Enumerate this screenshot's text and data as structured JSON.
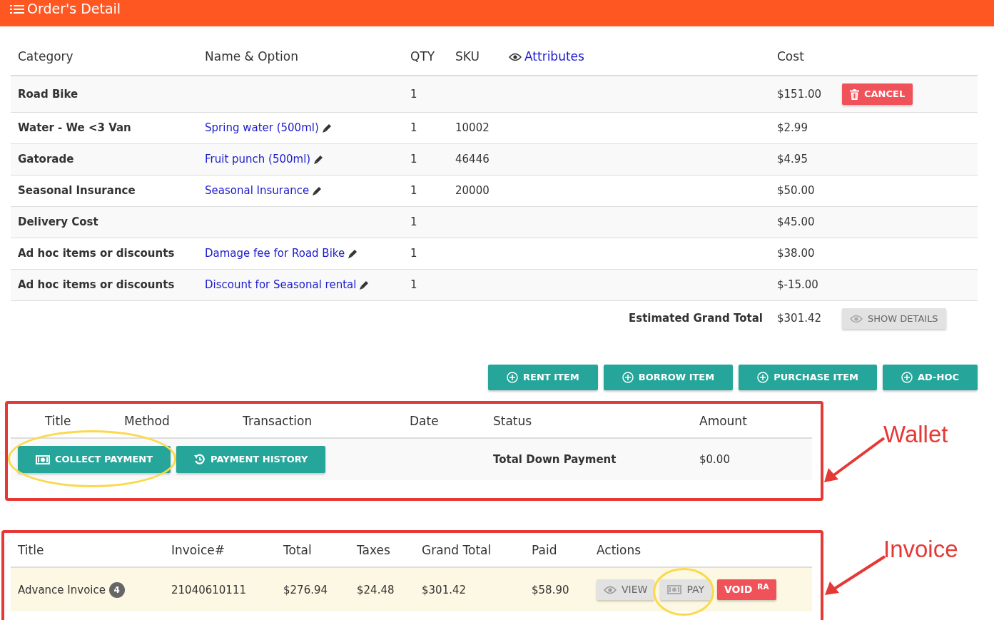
{
  "header": {
    "title": "Order's Detail"
  },
  "order_table": {
    "columns": [
      {
        "label": "Category",
        "kind": "text"
      },
      {
        "label": "Name & Option",
        "kind": "text"
      },
      {
        "label": "QTY",
        "kind": "text"
      },
      {
        "label": "SKU",
        "kind": "text"
      },
      {
        "label": "Attributes",
        "kind": "link"
      },
      {
        "label": "Cost",
        "kind": "text"
      }
    ],
    "rows": [
      {
        "category": "Road Bike",
        "qty": "1",
        "cost": "$151.00",
        "action": "CANCEL"
      },
      {
        "category": "Water - We <3 Van",
        "name": "Spring water (500ml)",
        "qty": "1",
        "sku": "10002",
        "cost": "$2.99"
      },
      {
        "category": "Gatorade",
        "name": "Fruit punch (500ml)",
        "qty": "1",
        "sku": "46446",
        "cost": "$4.95"
      },
      {
        "category": "Seasonal Insurance",
        "name": "Seasonal Insurance",
        "qty": "1",
        "sku": "20000",
        "cost": "$50.00"
      },
      {
        "category": "Delivery Cost",
        "qty": "1",
        "cost": "$45.00"
      },
      {
        "category": "Ad hoc items or discounts",
        "name": "Damage fee for Road Bike",
        "qty": "1",
        "cost": "$38.00"
      },
      {
        "category": "Ad hoc items or discounts",
        "name": "Discount for Seasonal rental",
        "qty": "1",
        "cost": "$-15.00"
      }
    ],
    "grand_total": {
      "label": "Estimated Grand Total",
      "value": "$301.42",
      "button": "SHOW DETAILS"
    }
  },
  "add_buttons": [
    "RENT ITEM",
    "BORROW ITEM",
    "PURCHASE ITEM",
    "AD-HOC"
  ],
  "wallet": {
    "annotation": "Wallet",
    "columns": [
      "Title",
      "Method",
      "Transaction",
      "Date",
      "Status",
      "Amount"
    ],
    "buttons": [
      {
        "label": "COLLECT PAYMENT",
        "kind": "money",
        "highlighted": true
      },
      {
        "label": "PAYMENT HISTORY",
        "kind": "history",
        "highlighted": false
      }
    ],
    "status": "Total Down Payment",
    "amount": "$0.00"
  },
  "invoice": {
    "annotation": "Invoice",
    "columns": [
      "Title",
      "Invoice#",
      "Total",
      "Taxes",
      "Grand Total",
      "Paid",
      "Actions"
    ],
    "rows": [
      {
        "title": "Advance Invoice",
        "count": "4",
        "invoice_no": "21040610111",
        "total": "$276.94",
        "taxes": "$24.48",
        "grand_total": "$301.42",
        "paid": "$58.90",
        "actions": [
          {
            "kind": "view",
            "label": "VIEW",
            "highlighted": false
          },
          {
            "kind": "pay",
            "label": "PAY",
            "highlighted": true
          },
          {
            "kind": "void",
            "label": "VOID $^{RA}$",
            "highlighted": false
          }
        ]
      }
    ]
  }
}
